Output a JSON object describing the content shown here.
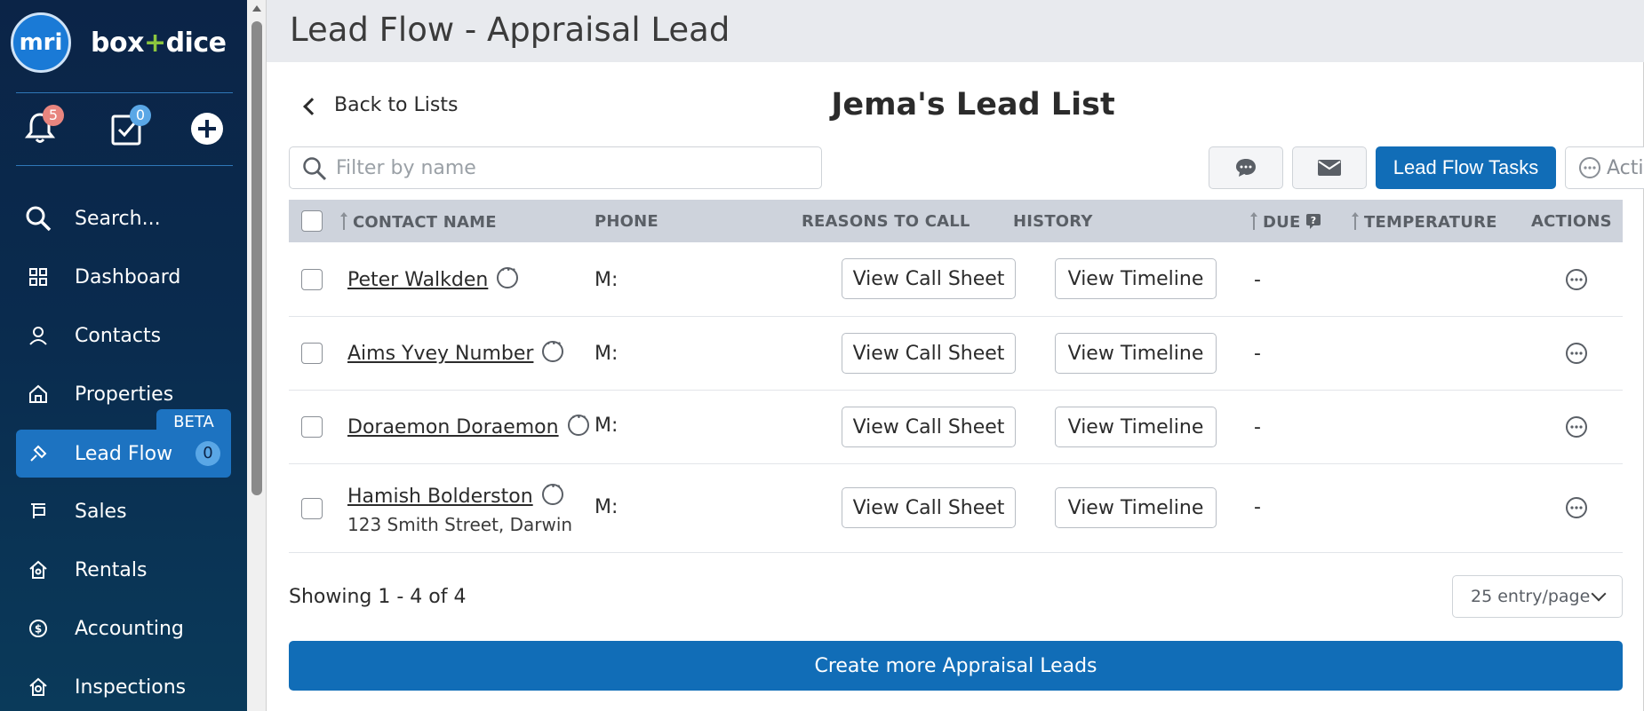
{
  "brand": {
    "logo_text": "mri",
    "name_left": "box",
    "name_plus": "+",
    "name_right": "dice"
  },
  "quick_actions": {
    "notifications_count": "5",
    "tasks_count": "0"
  },
  "sidebar": {
    "items": [
      {
        "label": "Search..."
      },
      {
        "label": "Dashboard"
      },
      {
        "label": "Contacts"
      },
      {
        "label": "Properties"
      },
      {
        "label": "Lead Flow",
        "badge": "BETA",
        "count": "0"
      },
      {
        "label": "Sales"
      },
      {
        "label": "Rentals"
      },
      {
        "label": "Accounting"
      },
      {
        "label": "Inspections"
      }
    ]
  },
  "header": {
    "title": "Lead Flow - Appraisal Lead"
  },
  "list": {
    "back_label": "Back to Lists",
    "title": "Jema's Lead List",
    "filter_placeholder": "Filter by name",
    "lead_flow_tasks_label": "Lead Flow Tasks",
    "actions_label": "Actions"
  },
  "table": {
    "columns": [
      "CONTACT NAME",
      "PHONE",
      "REASONS TO CALL",
      "HISTORY",
      "DUE",
      "TEMPERATURE",
      "ACTIONS"
    ],
    "rows": [
      {
        "name": "Peter Walkden",
        "address": "",
        "phone": "M:",
        "call_sheet": "View Call Sheet",
        "timeline": "View Timeline",
        "due": "-"
      },
      {
        "name": "Aims Yvey Number",
        "address": "",
        "phone": "M:",
        "call_sheet": "View Call Sheet",
        "timeline": "View Timeline",
        "due": "-"
      },
      {
        "name": "Doraemon Doraemon",
        "address": "",
        "phone": "M:",
        "call_sheet": "View Call Sheet",
        "timeline": "View Timeline",
        "due": "-"
      },
      {
        "name": "Hamish Bolderston",
        "address": "123 Smith Street, Darwin",
        "phone": "M:",
        "call_sheet": "View Call Sheet",
        "timeline": "View Timeline",
        "due": "-"
      }
    ]
  },
  "footer": {
    "showing": "Showing 1 - 4 of 4",
    "per_page": "25 entry/page",
    "create_label": "Create more Appraisal Leads"
  },
  "colors": {
    "primary": "#116db7",
    "sidebar": "#0b2447",
    "accent_green": "#8cc63f"
  }
}
